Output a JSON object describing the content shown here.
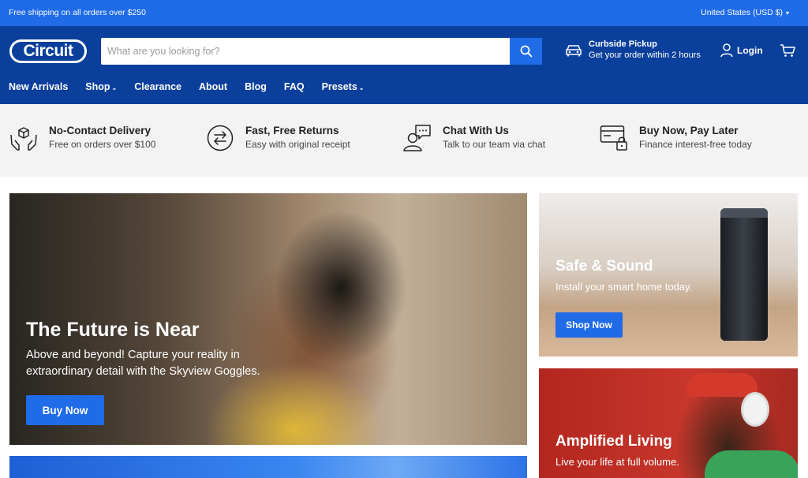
{
  "announcement": {
    "text": "Free shipping on all orders over $250",
    "region": "United States (USD $)"
  },
  "header": {
    "logo": "Circuit",
    "search": {
      "placeholder": "What are you looking for?"
    },
    "curbside": {
      "title": "Curbside Pickup",
      "subtitle": "Get your order within 2 hours"
    },
    "login_label": "Login"
  },
  "nav": {
    "items": [
      {
        "label": "New Arrivals"
      },
      {
        "label": "Shop"
      },
      {
        "label": "Clearance"
      },
      {
        "label": "About"
      },
      {
        "label": "Blog"
      },
      {
        "label": "FAQ"
      },
      {
        "label": "Presets"
      }
    ]
  },
  "features": [
    {
      "icon": "hands-box-icon",
      "title": "No-Contact Delivery",
      "subtitle": "Free on orders over $100"
    },
    {
      "icon": "returns-icon",
      "title": "Fast, Free Returns",
      "subtitle": "Easy with original receipt"
    },
    {
      "icon": "chat-icon",
      "title": "Chat With Us",
      "subtitle": "Talk to our team via chat"
    },
    {
      "icon": "card-lock-icon",
      "title": "Buy Now, Pay Later",
      "subtitle": "Finance interest-free today"
    }
  ],
  "hero": {
    "title": "The Future is Near",
    "text": "Above and beyond! Capture your reality in extraordinary detail with the Skyview Goggles.",
    "button": "Buy Now"
  },
  "promo1": {
    "title": "Safe & Sound",
    "text": "Install your smart home today.",
    "button": "Shop Now"
  },
  "promo2": {
    "title": "Amplified Living",
    "text": "Live your life at full volume."
  },
  "colors": {
    "topbar": "#1f6be8",
    "header": "#0a3f9c",
    "accent": "#1f6be8",
    "strip": "#f3f3f3"
  }
}
